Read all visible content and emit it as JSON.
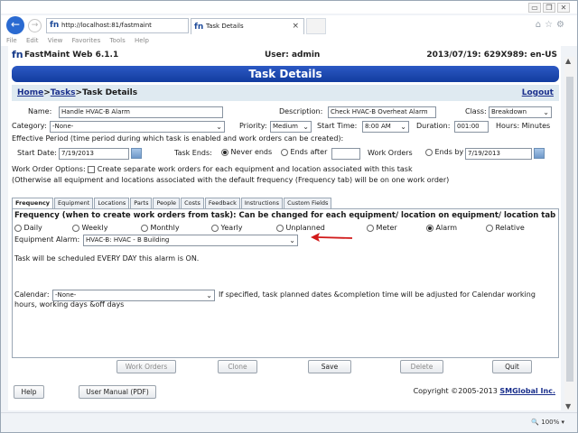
{
  "browser": {
    "url": "http://localhost:81/fastmaint",
    "url_host": "localhost",
    "tab_title": "Task Details",
    "menu": [
      "File",
      "Edit",
      "View",
      "Favorites",
      "Tools",
      "Help"
    ],
    "zoom": "100%"
  },
  "app": {
    "name": "FastMaint Web 6.1.1",
    "user": "User: admin",
    "date_info": "2013/07/19: 629X989: en-US",
    "page_title": "Task Details",
    "breadcrumb": {
      "home": "Home",
      "tasks": "Tasks",
      "current": "Task Details",
      "sep": ">"
    },
    "logout": "Logout"
  },
  "form": {
    "name_label": "Name:",
    "name_value": "Handle HVAC-B Alarm",
    "description_label": "Description:",
    "description_value": "Check HVAC-B Overheat Alarm",
    "class_label": "Class:",
    "class_value": "Breakdown",
    "category_label": "Category:",
    "category_value": "-None-",
    "priority_label": "Priority:",
    "priority_value": "Medium",
    "start_time_label": "Start Time:",
    "start_time_value": "8:00 AM",
    "duration_label": "Duration:",
    "duration_value": "001:00",
    "hours_label": "Hours: Minutes",
    "effective_period": "Effective Period (time period during which task is enabled and work orders can be created):",
    "start_date_label": "Start Date:",
    "start_date_value": "7/19/2013",
    "task_ends_label": "Task Ends:",
    "never_ends": "Never ends",
    "ends_after": "Ends after",
    "work_orders": "Work Orders",
    "ends_by": "Ends by",
    "ends_by_value": "7/19/2013",
    "wo_options_label": "Work Order Options:",
    "wo_options_text": "Create separate work orders for each equipment and location associated with this task",
    "wo_options_note": "(Otherwise all equipment and locations associated with the default frequency (Frequency tab) will be on one work order)"
  },
  "tabs": [
    "Frequency",
    "Equipment",
    "Locations",
    "Parts",
    "People",
    "Costs",
    "Feedback",
    "Instructions",
    "Custom Fields"
  ],
  "frequency": {
    "headline": "Frequency (when to create work orders from task):  Can be changed for each equipment/ location on equipment/ location tab",
    "options": [
      "Daily",
      "Weekly",
      "Monthly",
      "Yearly",
      "Unplanned",
      "Meter",
      "Alarm",
      "Relative"
    ],
    "selected": "Alarm",
    "equipment_alarm_label": "Equipment Alarm:",
    "equipment_alarm_value": "HVAC-B: HVAC - B Building",
    "schedule_note": "Task will be scheduled EVERY DAY this alarm is ON.",
    "calendar_label": "Calendar:",
    "calendar_value": "-None-",
    "calendar_note_1": "If specified, task planned dates &completion time will be adjusted for Calendar working",
    "calendar_note_2": "hours, working days &off days"
  },
  "buttons": {
    "work_orders": "Work Orders",
    "clone": "Clone",
    "save": "Save",
    "delete": "Delete",
    "quit": "Quit",
    "help": "Help",
    "user_manual": "User Manual (PDF)"
  },
  "footer": {
    "copyright": "Copyright ©2005-2013",
    "company": "SMGlobal Inc."
  },
  "colors": {
    "header_blue": "#1f4bb3",
    "breadcrumb_bg": "#dfeaf1",
    "arrow_red": "#d11a1a"
  }
}
